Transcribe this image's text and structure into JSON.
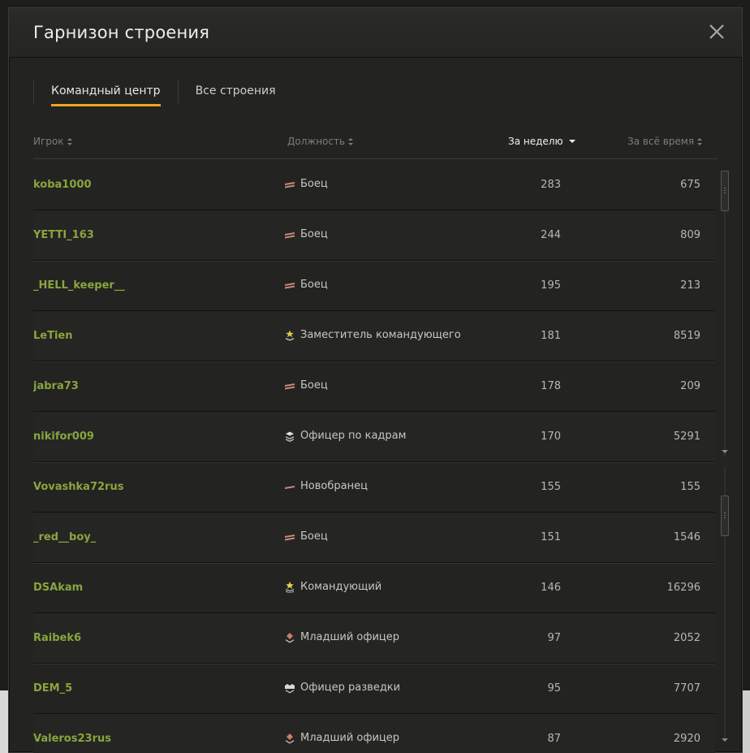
{
  "window": {
    "title": "Гарнизон строения"
  },
  "tabs": [
    {
      "label": "Командный центр",
      "active": true
    },
    {
      "label": "Все строения",
      "active": false
    }
  ],
  "columns": {
    "player": "Игрок",
    "role": "Должность",
    "week": "За неделю",
    "total": "За всё время"
  },
  "colors": {
    "accent": "#f0a51c",
    "player": "#8aa43c"
  },
  "rows": [
    {
      "player": "koba1000",
      "role": "Боец",
      "role_icon": "private-rank-icon",
      "week": "283",
      "total": "675"
    },
    {
      "player": "YETTI_163",
      "role": "Боец",
      "role_icon": "private-rank-icon",
      "week": "244",
      "total": "809"
    },
    {
      "player": "_HELL_keeper__",
      "role": "Боец",
      "role_icon": "private-rank-icon",
      "week": "195",
      "total": "213"
    },
    {
      "player": "LeTien",
      "role": "Заместитель командующего",
      "role_icon": "deputy-commander-rank-icon",
      "week": "181",
      "total": "8519"
    },
    {
      "player": "jabra73",
      "role": "Боец",
      "role_icon": "private-rank-icon",
      "week": "178",
      "total": "209"
    },
    {
      "player": "nikifor009",
      "role": "Офицер по кадрам",
      "role_icon": "personnel-officer-rank-icon",
      "week": "170",
      "total": "5291"
    },
    {
      "player": "Vovashka72rus",
      "role": "Новобранец",
      "role_icon": "recruit-rank-icon",
      "week": "155",
      "total": "155"
    },
    {
      "player": "_red__boy_",
      "role": "Боец",
      "role_icon": "private-rank-icon",
      "week": "151",
      "total": "1546"
    },
    {
      "player": "DSAkam",
      "role": "Командующий",
      "role_icon": "commander-rank-icon",
      "week": "146",
      "total": "16296"
    },
    {
      "player": "Raibek6",
      "role": "Младший офицер",
      "role_icon": "junior-officer-rank-icon",
      "week": "97",
      "total": "2052"
    },
    {
      "player": "DEM_5",
      "role": "Офицер разведки",
      "role_icon": "intelligence-officer-rank-icon",
      "week": "95",
      "total": "7707"
    },
    {
      "player": "Valeros23rus",
      "role": "Младший офицер",
      "role_icon": "junior-officer-rank-icon",
      "week": "87",
      "total": "2920"
    }
  ]
}
